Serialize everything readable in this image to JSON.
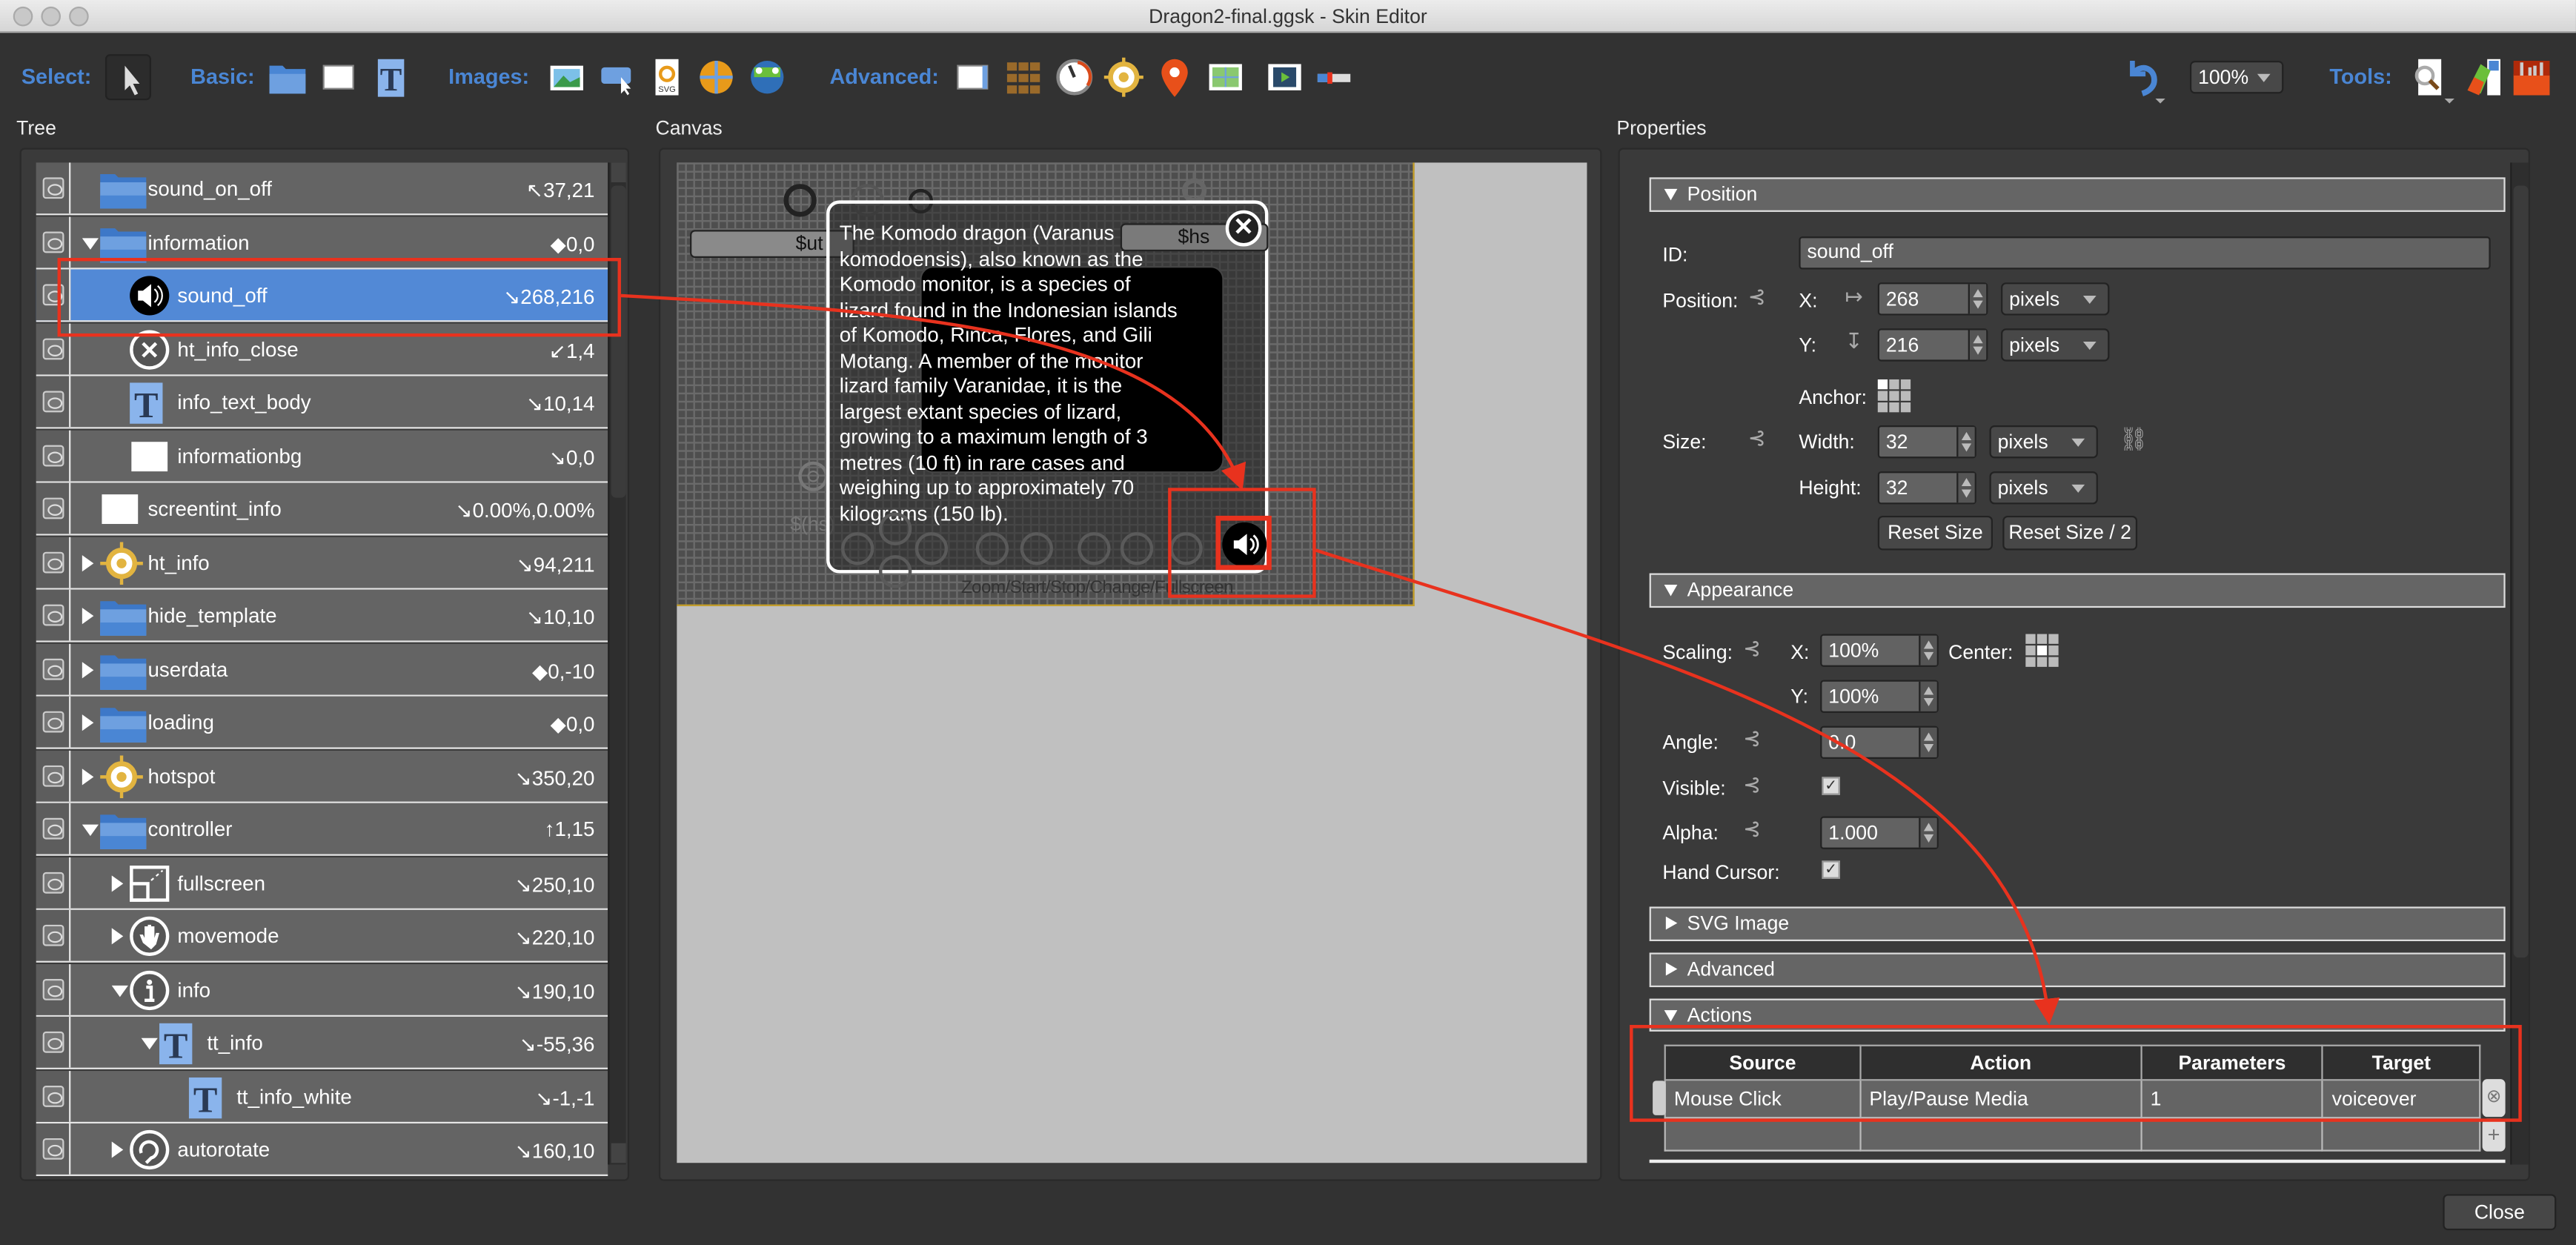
{
  "window": {
    "title": "Dragon2-final.ggsk - Skin Editor"
  },
  "toolbar": {
    "select_label": "Select:",
    "basic_label": "Basic:",
    "images_label": "Images:",
    "advanced_label": "Advanced:",
    "tools_label": "Tools:",
    "select_icons": [
      "pointer-icon"
    ],
    "basic_icons": [
      "folder-icon",
      "rectangle-icon",
      "text-icon"
    ],
    "images_icons": [
      "image-icon",
      "button-icon",
      "svg-icon",
      "panorama-icon",
      "cloner-icon"
    ],
    "advanced_icons": [
      "scrollarea-icon",
      "cloner-grid-icon",
      "timer-icon",
      "hotspot-icon",
      "map-pin-icon",
      "map-icon",
      "video-icon",
      "progress-bar-icon"
    ],
    "tools_icons": [
      "find-icon",
      "palette-icon",
      "toolbox-icon"
    ],
    "zoom_value": "100%"
  },
  "sections": {
    "tree": "Tree",
    "canvas": "Canvas",
    "properties": "Properties"
  },
  "tree": {
    "rows": [
      {
        "name": "sound_on_off",
        "value": "↖37,21",
        "level": 1,
        "icon": "folder",
        "arrow": ""
      },
      {
        "name": "information",
        "value": "◆0,0",
        "level": 1,
        "icon": "folder",
        "arrow": "d"
      },
      {
        "name": "sound_off",
        "value": "↘268,216",
        "level": 2,
        "icon": "speaker",
        "arrow": "",
        "selected": true
      },
      {
        "name": "ht_info_close",
        "value": "↙1,4",
        "level": 2,
        "icon": "close",
        "arrow": ""
      },
      {
        "name": "info_text_body",
        "value": "↘10,14",
        "level": 2,
        "icon": "text",
        "arrow": ""
      },
      {
        "name": "informationbg",
        "value": "↘0,0",
        "level": 2,
        "icon": "rect",
        "arrow": ""
      },
      {
        "name": "screentint_info",
        "value": "↘0.00%,0.00%",
        "level": 1,
        "icon": "rect",
        "arrow": ""
      },
      {
        "name": "ht_info",
        "value": "↘94,211",
        "level": 1,
        "icon": "hotspot",
        "arrow": "r"
      },
      {
        "name": "hide_template",
        "value": "↘10,10",
        "level": 1,
        "icon": "folder",
        "arrow": "r"
      },
      {
        "name": "userdata",
        "value": "◆0,-10",
        "level": 1,
        "icon": "folder",
        "arrow": "r"
      },
      {
        "name": "loading",
        "value": "◆0,0",
        "level": 1,
        "icon": "folder",
        "arrow": "r"
      },
      {
        "name": "hotspot",
        "value": "↘350,20",
        "level": 1,
        "icon": "hotspot",
        "arrow": "r"
      },
      {
        "name": "controller",
        "value": "↑1,15",
        "level": 1,
        "icon": "folder",
        "arrow": "d"
      },
      {
        "name": "fullscreen",
        "value": "↘250,10",
        "level": 2,
        "icon": "fullscreen",
        "arrow": "r"
      },
      {
        "name": "movemode",
        "value": "↘220,10",
        "level": 2,
        "icon": "hand",
        "arrow": "r"
      },
      {
        "name": "info",
        "value": "↘190,10",
        "level": 2,
        "icon": "info",
        "arrow": "d"
      },
      {
        "name": "tt_info",
        "value": "↘-55,36",
        "level": 3,
        "icon": "text",
        "arrow": "d"
      },
      {
        "name": "tt_info_white",
        "value": "↘-1,-1",
        "level": 4,
        "icon": "text",
        "arrow": ""
      },
      {
        "name": "autorotate",
        "value": "↘160,10",
        "level": 2,
        "icon": "rotate",
        "arrow": "r"
      }
    ]
  },
  "canvas": {
    "ut_label": "$ut",
    "hs_label": "$hs",
    "hs_paren": "$(hs)",
    "info_lines": [
      "The Komodo dragon (Varanus",
      "komodoensis), also known as the",
      "Komodo monitor, is a species of",
      "lizard found in the Indonesian islands",
      "of Komodo, Rinca, Flores, and Gili",
      "Motang. A member of the monitor",
      "lizard family Varanidae, it is the",
      "largest extant species of lizard,",
      "growing to a maximum length of 3",
      "metres (10 ft) in rare cases and",
      "weighing up to approximately 70",
      "kilograms (150 lb)."
    ],
    "tooltip_overlap": "Zoom/Start/Stop/Change/Fullscreen"
  },
  "properties": {
    "position": {
      "header": "Position",
      "id_label": "ID:",
      "id_value": "sound_off",
      "position_label": "Position:",
      "x_label": "X:",
      "x_value": "268",
      "x_unit": "pixels",
      "y_label": "Y:",
      "y_value": "216",
      "y_unit": "pixels",
      "anchor_label": "Anchor:",
      "size_label": "Size:",
      "width_label": "Width:",
      "width_value": "32",
      "width_unit": "pixels",
      "height_label": "Height:",
      "height_value": "32",
      "height_unit": "pixels",
      "reset_size": "Reset Size",
      "reset_size_half": "Reset Size / 2"
    },
    "appearance": {
      "header": "Appearance",
      "scaling_label": "Scaling:",
      "x_label": "X:",
      "scale_x": "100%",
      "center_label": "Center:",
      "y_label": "Y:",
      "scale_y": "100%",
      "angle_label": "Angle:",
      "angle": "0.0",
      "visible_label": "Visible:",
      "visible": true,
      "alpha_label": "Alpha:",
      "alpha": "1.000",
      "hand_cursor_label": "Hand Cursor:",
      "hand_cursor": true
    },
    "svg_header": "SVG Image",
    "advanced_header": "Advanced",
    "actions_header": "Actions",
    "actions": {
      "columns": [
        "Source",
        "Action",
        "Parameters",
        "Target"
      ],
      "rows": [
        [
          "Mouse Click",
          "Play/Pause Media",
          "1",
          "voiceover"
        ]
      ]
    }
  },
  "footer": {
    "close": "Close"
  },
  "colors": {
    "accent": "#4a86d4",
    "selection": "#5289d6",
    "annotation_red": "#e8321e",
    "background": "#323232"
  }
}
